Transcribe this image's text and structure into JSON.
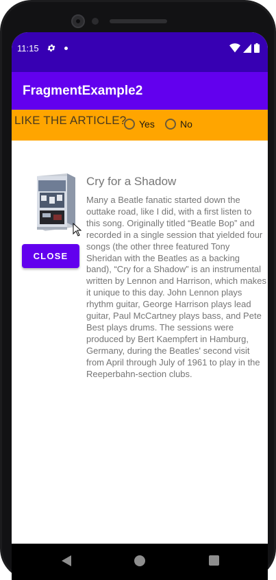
{
  "status_bar": {
    "time": "11:15",
    "icons": [
      "gear-icon",
      "notification-dot-icon",
      "wifi-icon",
      "signal-icon",
      "battery-icon"
    ]
  },
  "app_bar": {
    "title": "FragmentExample2"
  },
  "rating": {
    "question": "LIKE THE ARTICLE?",
    "options": [
      {
        "label": "Yes",
        "selected": false
      },
      {
        "label": "No",
        "selected": false
      }
    ]
  },
  "song": {
    "title": "Cry for a Shadow",
    "body": "Many a Beatle fanatic started down the outtake road, like I did, with a first listen to this song. Originally titled “Beatle Bop” and recorded in a single session that yielded four songs (the other three featured Tony Sheridan with the Beatles as a backing band), “Cry for a Shadow” is an instrumental written by Lennon and Harrison, which makes it unique to this day. John Lennon plays rhythm guitar, George Harrison plays lead guitar, Paul McCartney plays bass, and Pete Best plays drums. The sessions were produced by Bert Kaempfert in Hamburg, Germany, during the Beatles' second visit from April through July of 1961 to play in the Reeperbahn-section clubs.",
    "album_art_icon": "album-cover-image"
  },
  "actions": {
    "close_label": "CLOSE"
  },
  "nav_bar": {
    "icons": [
      "back-icon",
      "home-icon",
      "recents-icon"
    ]
  },
  "colors": {
    "status_bar": "#3700b3",
    "app_bar": "#6200ee",
    "rating_bar": "#ffa500",
    "button": "#6200ee",
    "body_text": "#757575"
  }
}
